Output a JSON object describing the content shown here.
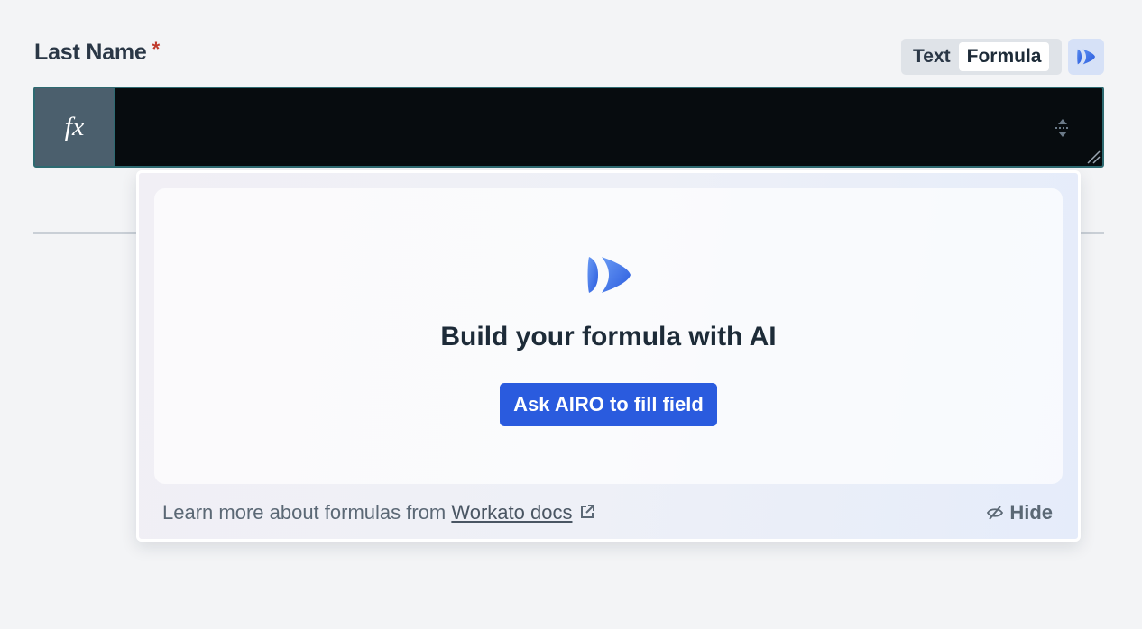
{
  "field": {
    "label": "Last Name",
    "required_marker": "*",
    "mode_options": [
      "Text",
      "Formula"
    ],
    "selected_mode": "Formula",
    "fx_glyph": "fx",
    "value": ""
  },
  "popover": {
    "title": "Build your formula with AI",
    "ask_button_label": "Ask AIRO to fill field",
    "footer_prefix": "Learn more about formulas from ",
    "docs_link_label": "Workato docs",
    "hide_label": "Hide"
  },
  "icons": {
    "airo": "airo-logo-icon",
    "fx": "function-icon",
    "stepper": "stepper-icon",
    "resize": "resize-grip-icon",
    "external": "external-link-icon",
    "hide": "eye-slash-icon"
  },
  "colors": {
    "accent": "#2a5bde",
    "required": "#c0392b",
    "input_bg": "#070c0f",
    "input_border": "#2d6a71",
    "fx_bg": "#4b5f6d"
  }
}
